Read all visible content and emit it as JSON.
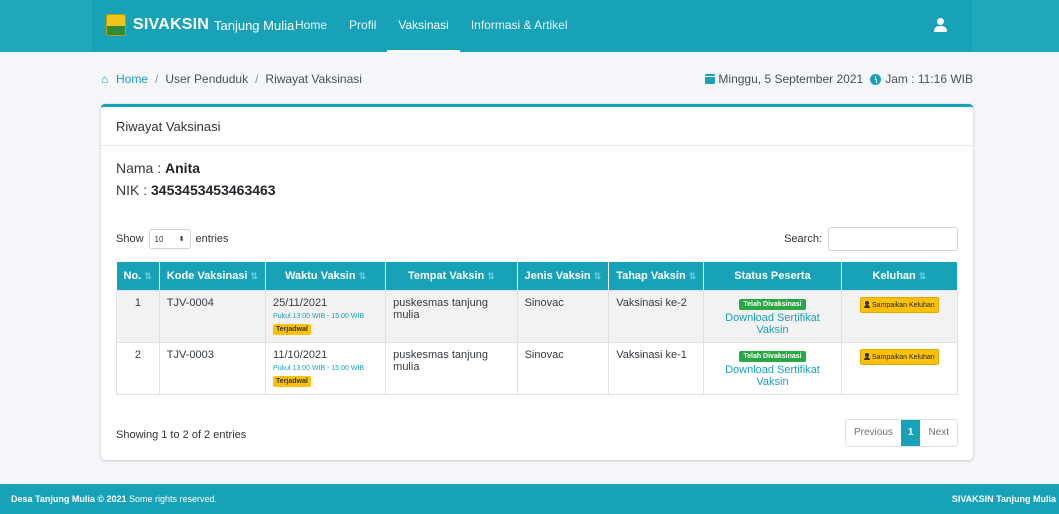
{
  "navbar": {
    "brand": "SIVAKSIN",
    "brand_sub": "Tanjung Mulia",
    "links": [
      "Home",
      "Profil",
      "Vaksinasi",
      "Informasi & Artikel"
    ]
  },
  "breadcrumb": {
    "items": [
      "Home",
      "User Penduduk",
      "Riwayat Vaksinasi"
    ],
    "separator": "/"
  },
  "datetime": {
    "date": "Minggu, 5 September 2021",
    "time": "Jam : 11:16 WIB"
  },
  "card": {
    "title": "Riwayat Vaksinasi",
    "nama_label": "Nama : ",
    "nama_value": "Anita",
    "nik_label": "NIK : ",
    "nik_value": "3453453453463463"
  },
  "datatable": {
    "show_label": "Show",
    "entries_value": "10",
    "entries_label": "entries",
    "search_label": "Search:",
    "columns": [
      "No.",
      "Kode Vaksinasi",
      "Waktu Vaksin",
      "Tempat Vaksin",
      "Jenis Vaksin",
      "Tahap Vaksin",
      "Status Peserta",
      "Keluhan"
    ],
    "rows": [
      {
        "no": "1",
        "kode": "TJV-0004",
        "tanggal": "25/11/2021",
        "pukul": "Pukul 13:00 WIB - 15:00 WIB",
        "jadwal": "Terjadwal",
        "tempat": "puskesmas tanjung mulia",
        "jenis": "Sinovac",
        "tahap": "Vaksinasi ke-2",
        "status": "Telah Divaksinasi",
        "download": "Download Sertifikat Vaksin",
        "keluhan": "Sampaikan Keluhan"
      },
      {
        "no": "2",
        "kode": "TJV-0003",
        "tanggal": "11/10/2021",
        "pukul": "Pukul 13:00 WIB - 15:00 WIB",
        "jadwal": "Terjadwal",
        "tempat": "puskesmas tanjung mulia",
        "jenis": "Sinovac",
        "tahap": "Vaksinasi ke-1",
        "status": "Telah Divaksinasi",
        "download": "Download Sertifikat Vaksin",
        "keluhan": "Sampaikan Keluhan"
      }
    ],
    "info": "Showing 1 to 2 of 2 entries",
    "pager": {
      "previous": "Previous",
      "current": "1",
      "next": "Next"
    }
  },
  "footer": {
    "left_bold": "Desa Tanjung Mulia © 2021",
    "left_rest": " Some rights reserved.",
    "right": "SIVAKSIN Tanjung Mulia"
  },
  "colors": {
    "primary": "#17a2b8",
    "warning": "#ffc107",
    "success": "#28a745"
  }
}
